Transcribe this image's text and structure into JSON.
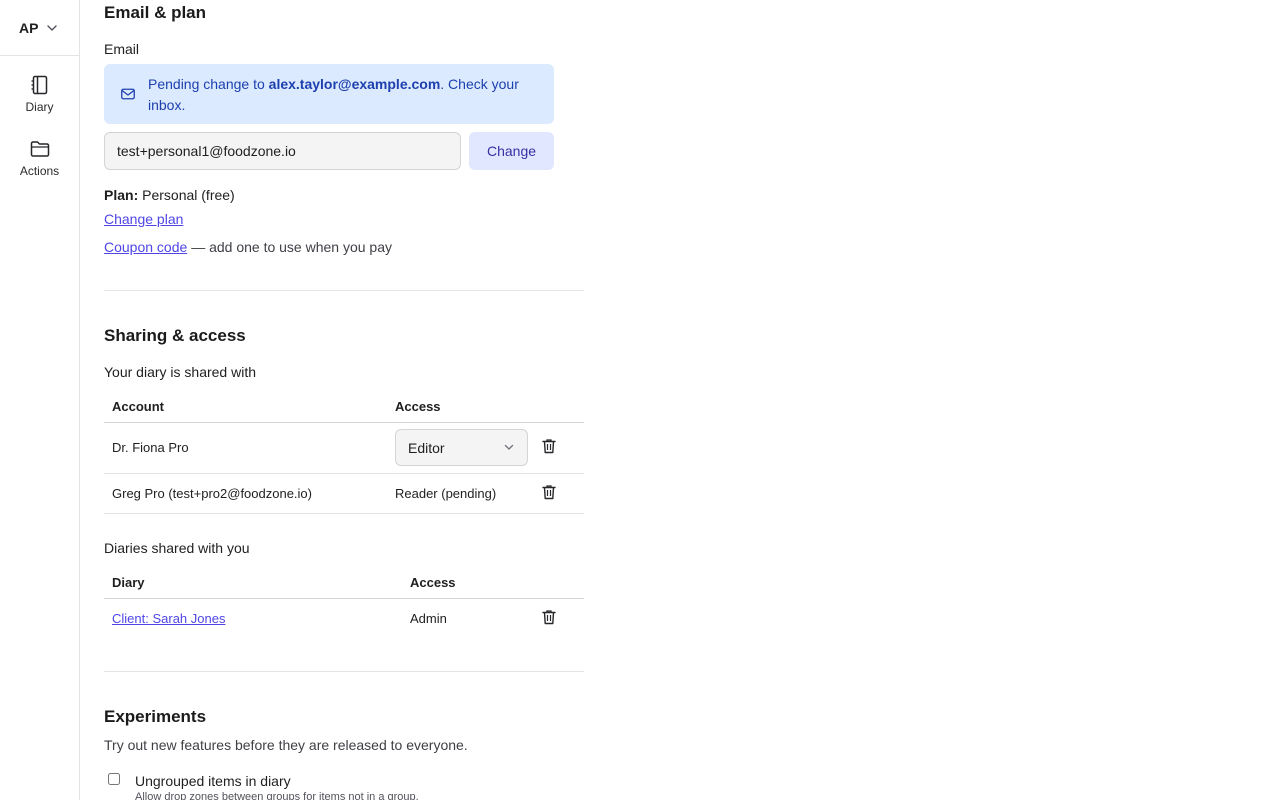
{
  "sidebar": {
    "account_initials": "AP",
    "items": [
      {
        "label": "Diary",
        "icon": "notebook-icon"
      },
      {
        "label": "Actions",
        "icon": "folder-icon"
      }
    ]
  },
  "email_plan": {
    "title": "Email & plan",
    "email_label": "Email",
    "notice": {
      "prefix": "Pending change to ",
      "email": "alex.taylor@example.com",
      "suffix": ". Check your inbox."
    },
    "email_value": "test+personal1@foodzone.io",
    "change_button": "Change",
    "plan_label": "Plan:",
    "plan_value": "Personal (free)",
    "change_plan_link": "Change plan",
    "coupon_link": "Coupon code",
    "coupon_suffix": "— add one to use when you pay"
  },
  "sharing": {
    "title": "Sharing & access",
    "shared_with_label": "Your diary is shared with",
    "shared_with_headers": {
      "account": "Account",
      "access": "Access"
    },
    "shared_with_rows": [
      {
        "account": "Dr. Fiona Pro",
        "access": "Editor",
        "access_type": "select"
      },
      {
        "account": "Greg Pro (test+pro2@foodzone.io)",
        "access": "Reader (pending)",
        "access_type": "text"
      }
    ],
    "shared_with_you_label": "Diaries shared with you",
    "shared_with_you_headers": {
      "diary": "Diary",
      "access": "Access"
    },
    "shared_with_you_rows": [
      {
        "diary": "Client: Sarah Jones",
        "access": "Admin"
      }
    ]
  },
  "experiments": {
    "title": "Experiments",
    "description": "Try out new features before they are released to everyone.",
    "items": [
      {
        "label": "Ungrouped items in diary",
        "help": "Allow drop zones between groups for items not in a group.",
        "checked": false
      }
    ]
  },
  "colors": {
    "accent": "#4f46e5",
    "notice_bg": "#dbeafe",
    "notice_text": "#1e40af",
    "button_bg": "#e0e7ff"
  }
}
